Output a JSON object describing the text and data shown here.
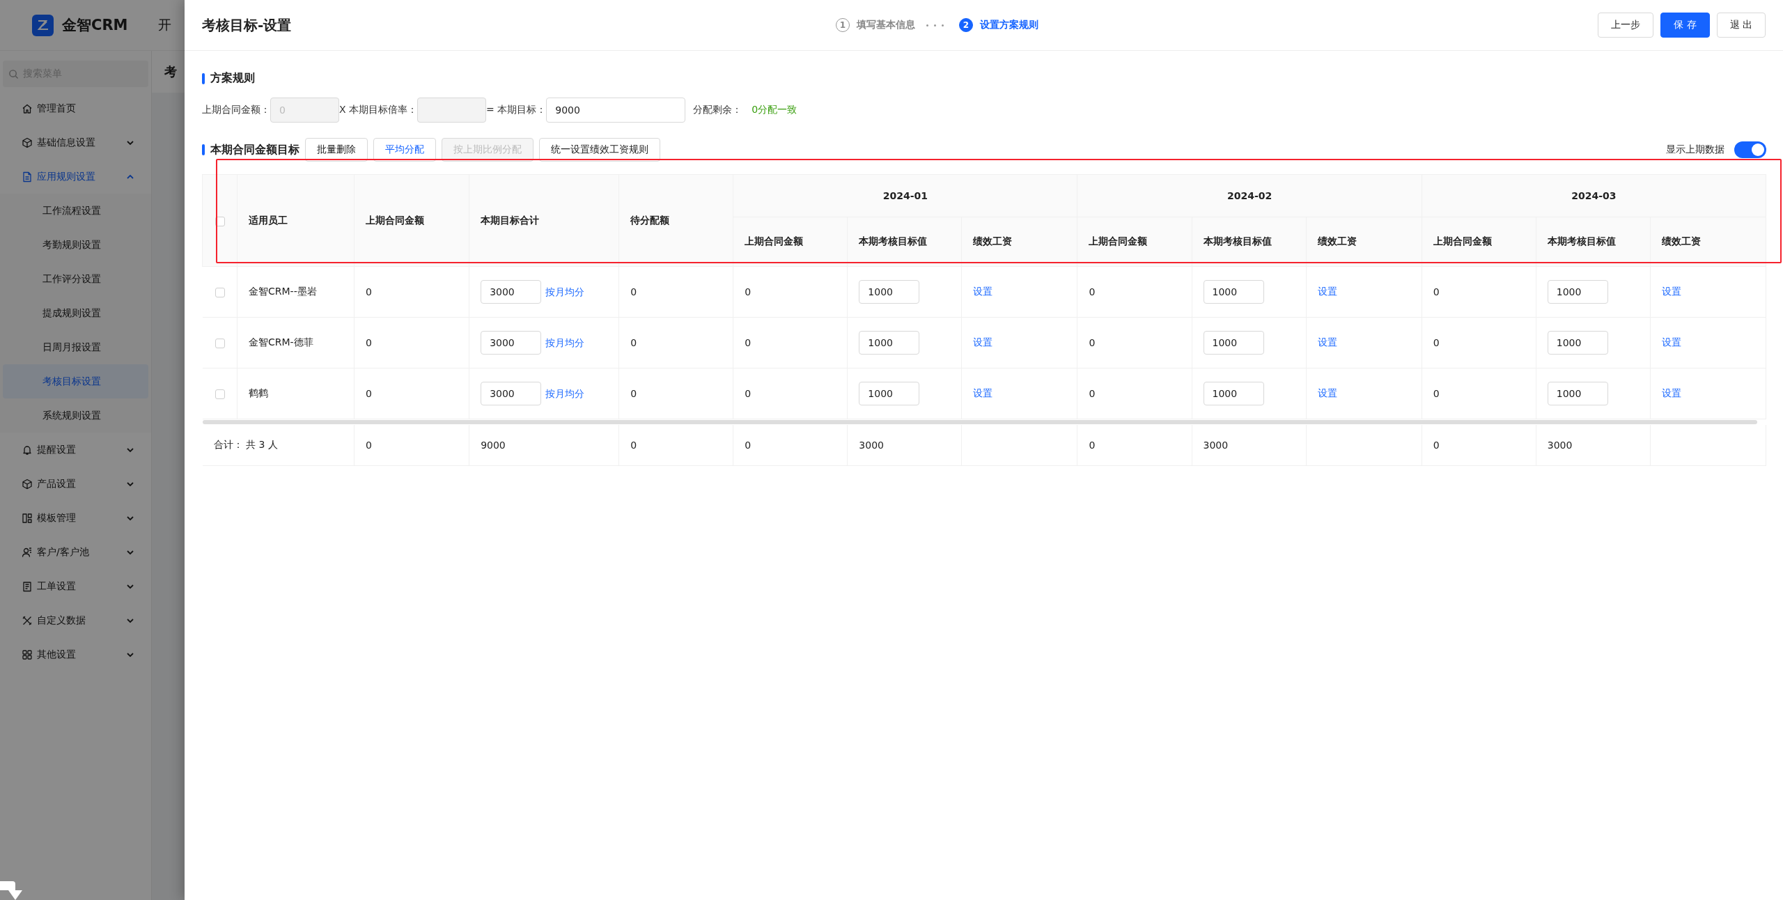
{
  "app": {
    "logo_text": "金智CRM",
    "top_nav_text": "开",
    "page_title": "考"
  },
  "sidebar": {
    "search_placeholder": "搜索菜单",
    "items": [
      {
        "label": "管理首页",
        "kind": "link"
      },
      {
        "label": "基础信息设置",
        "kind": "group",
        "expanded": false
      },
      {
        "label": "应用规则设置",
        "kind": "group",
        "expanded": true,
        "children": [
          {
            "label": "工作流程设置",
            "selected": false
          },
          {
            "label": "考勤规则设置",
            "selected": false
          },
          {
            "label": "工作评分设置",
            "selected": false
          },
          {
            "label": "提成规则设置",
            "selected": false
          },
          {
            "label": "日周月报设置",
            "selected": false
          },
          {
            "label": "考核目标设置",
            "selected": true
          },
          {
            "label": "系统规则设置",
            "selected": false
          }
        ]
      },
      {
        "label": "提醒设置",
        "kind": "group",
        "expanded": false
      },
      {
        "label": "产品设置",
        "kind": "group",
        "expanded": false
      },
      {
        "label": "模板管理",
        "kind": "group",
        "expanded": false
      },
      {
        "label": "客户/客户池",
        "kind": "group",
        "expanded": false
      },
      {
        "label": "工单设置",
        "kind": "group",
        "expanded": false
      },
      {
        "label": "自定义数据",
        "kind": "group",
        "expanded": false
      },
      {
        "label": "其他设置",
        "kind": "group",
        "expanded": false
      }
    ]
  },
  "drawer": {
    "title": "考核目标-设置",
    "steps": [
      {
        "number": "1",
        "label": "填写基本信息",
        "selected": false
      },
      {
        "number": "2",
        "label": "设置方案规则",
        "selected": true
      }
    ],
    "buttons": [
      {
        "label": "上一步",
        "kind": "default"
      },
      {
        "label": "保 存",
        "kind": "primary"
      },
      {
        "label": "退 出",
        "kind": "default"
      }
    ]
  },
  "rules": {
    "title": "方案规则",
    "fields": [
      {
        "label": "上期合同金额：",
        "value": "0",
        "disabled": true
      },
      {
        "label": "X 本期目标倍率：",
        "disabled": true
      },
      {
        "label": "= 本期目标：",
        "value": "9000",
        "disabled": false
      }
    ],
    "remainder_label": "分配剩余：",
    "remainder_value": "0分配一致"
  },
  "targets": {
    "title": "本期合同金额目标",
    "actions": [
      {
        "label": "批量删除",
        "kind": "default",
        "disabled": false
      },
      {
        "label": "平均分配",
        "kind": "accent",
        "disabled": false
      },
      {
        "label": "按上期比例分配",
        "kind": "default",
        "disabled": true
      },
      {
        "label": "统一设置绩效工资规则",
        "kind": "default",
        "disabled": false
      }
    ],
    "toggle": {
      "label": "显示上期数据",
      "on": true
    }
  },
  "table": {
    "header_checked": false,
    "columns": [
      "适用员工",
      "上期合同金额",
      "本期目标合计",
      "待分配额"
    ],
    "months": [
      {
        "label": "2024-01",
        "sub_columns": [
          "上期合同金额",
          "本期考核目标值",
          "绩效工资"
        ]
      },
      {
        "label": "2024-02",
        "sub_columns": [
          "上期合同金额",
          "本期考核目标值",
          "绩效工资"
        ]
      },
      {
        "label": "2024-03",
        "sub_columns": [
          "上期合同金额",
          "本期考核目标值",
          "绩效工资"
        ]
      }
    ],
    "rows": [
      {
        "checked": false,
        "employee": "金智CRM--墨岩",
        "prev_amount": "0",
        "target_total": "3000",
        "split_link": "按月均分",
        "pending": "0",
        "months": [
          {
            "prev": "0",
            "target": "1000",
            "salary_link": "设置"
          },
          {
            "prev": "0",
            "target": "1000",
            "salary_link": "设置"
          },
          {
            "prev": "0",
            "target": "1000",
            "salary_link": "设置"
          }
        ]
      },
      {
        "checked": false,
        "employee": "金智CRM-德菲",
        "prev_amount": "0",
        "target_total": "3000",
        "split_link": "按月均分",
        "pending": "0",
        "months": [
          {
            "prev": "0",
            "target": "1000",
            "salary_link": "设置"
          },
          {
            "prev": "0",
            "target": "1000",
            "salary_link": "设置"
          },
          {
            "prev": "0",
            "target": "1000",
            "salary_link": "设置"
          }
        ]
      },
      {
        "checked": false,
        "employee": "鹤鹤",
        "prev_amount": "0",
        "target_total": "3000",
        "split_link": "按月均分",
        "pending": "0",
        "months": [
          {
            "prev": "0",
            "target": "1000",
            "salary_link": "设置"
          },
          {
            "prev": "0",
            "target": "1000",
            "salary_link": "设置"
          },
          {
            "prev": "0",
            "target": "1000",
            "salary_link": "设置"
          }
        ]
      }
    ],
    "summary": {
      "label": "合计： 共 3 人",
      "prev_amount": "0",
      "target_total": "9000",
      "pending": "0",
      "months": [
        {
          "prev": "0",
          "target": "3000"
        },
        {
          "prev": "0",
          "target": "3000"
        },
        {
          "prev": "0",
          "target": "3000"
        }
      ]
    }
  }
}
